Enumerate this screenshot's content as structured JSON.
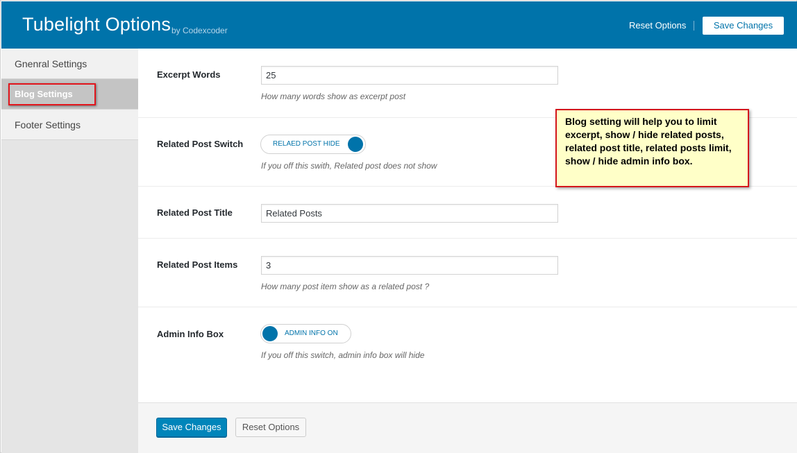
{
  "header": {
    "title": "Tubelight Options",
    "byline": "by Codexcoder",
    "reset_label": "Reset Options",
    "save_label": "Save Changes"
  },
  "sidebar": {
    "items": [
      {
        "label": "Gnenral Settings",
        "active": false
      },
      {
        "label": "Blog Settings",
        "active": true
      },
      {
        "label": "Footer Settings",
        "active": false
      }
    ]
  },
  "fields": {
    "excerpt_words": {
      "label": "Excerpt Words",
      "value": "25",
      "help": "How many words show as excerpt post"
    },
    "related_post_switch": {
      "label": "Related Post Switch",
      "toggle_text": "RELAED POST HIDE",
      "state": "off",
      "help": "If you off this swith, Related post does not show"
    },
    "related_post_title": {
      "label": "Related Post Title",
      "value": "Related Posts"
    },
    "related_post_items": {
      "label": "Related Post Items",
      "value": "3",
      "help": "How many post item show as a related post ?"
    },
    "admin_info_box": {
      "label": "Admin Info Box",
      "toggle_text": "ADMIN INFO ON",
      "state": "on",
      "help": "If you off this switch, admin info box will hide"
    }
  },
  "callout": {
    "text": "Blog setting will help you to limit excerpt, show / hide related posts, related post title, related posts limit, show / hide admin info box."
  },
  "footer": {
    "save_label": "Save Changes",
    "reset_label": "Reset Options"
  },
  "colors": {
    "brand": "#0073aa",
    "primary_button": "#0085ba",
    "highlight_border": "#e2151c",
    "callout_bg": "#ffffc8"
  }
}
